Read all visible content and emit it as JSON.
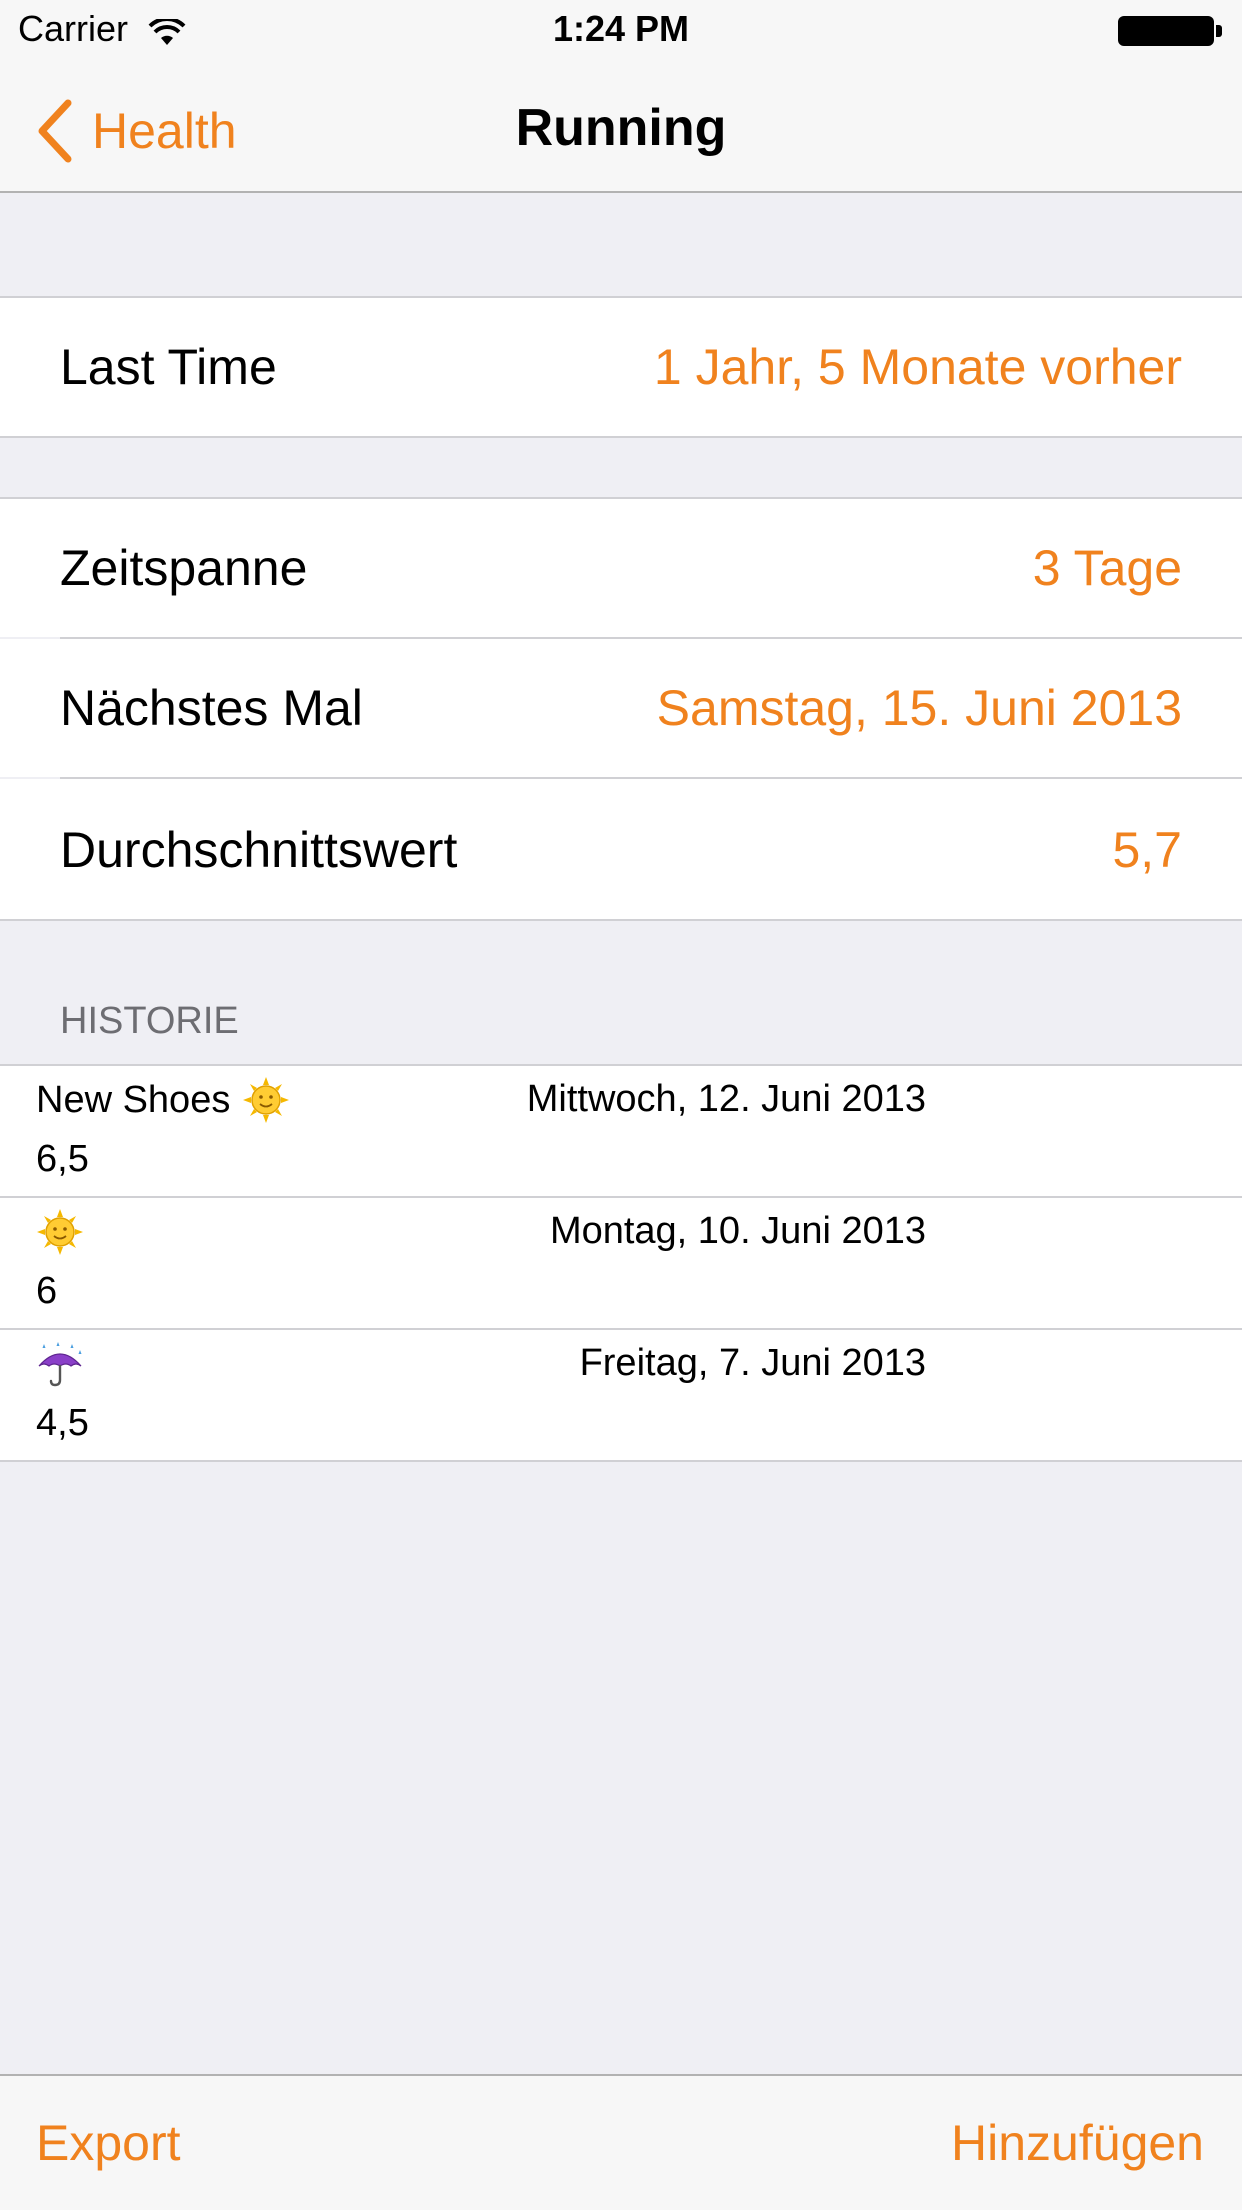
{
  "status_bar": {
    "carrier": "Carrier",
    "time": "1:24 PM"
  },
  "nav": {
    "back_label": "Health",
    "title": "Running"
  },
  "summary": {
    "last_time_label": "Last Time",
    "last_time_value": "1 Jahr, 5 Monate vorher"
  },
  "stats": [
    {
      "label": "Zeitspanne",
      "value": "3 Tage"
    },
    {
      "label": "Nächstes Mal",
      "value": "Samstag, 15. Juni 2013"
    },
    {
      "label": "Durchschnittswert",
      "value": "5,7"
    }
  ],
  "history": {
    "header": "HISTORIE",
    "entries": [
      {
        "note": "New Shoes",
        "icon": "sun-icon",
        "date": "Mittwoch, 12. Juni 2013",
        "value": "6,5"
      },
      {
        "note": "",
        "icon": "sun-icon",
        "date": "Montag, 10. Juni 2013",
        "value": "6"
      },
      {
        "note": "",
        "icon": "umbrella-rain-icon",
        "date": "Freitag, 7. Juni 2013",
        "value": "4,5"
      }
    ]
  },
  "toolbar": {
    "export_label": "Export",
    "add_label": "Hinzufügen"
  },
  "colors": {
    "accent": "#f0821e",
    "background": "#efeff4"
  }
}
